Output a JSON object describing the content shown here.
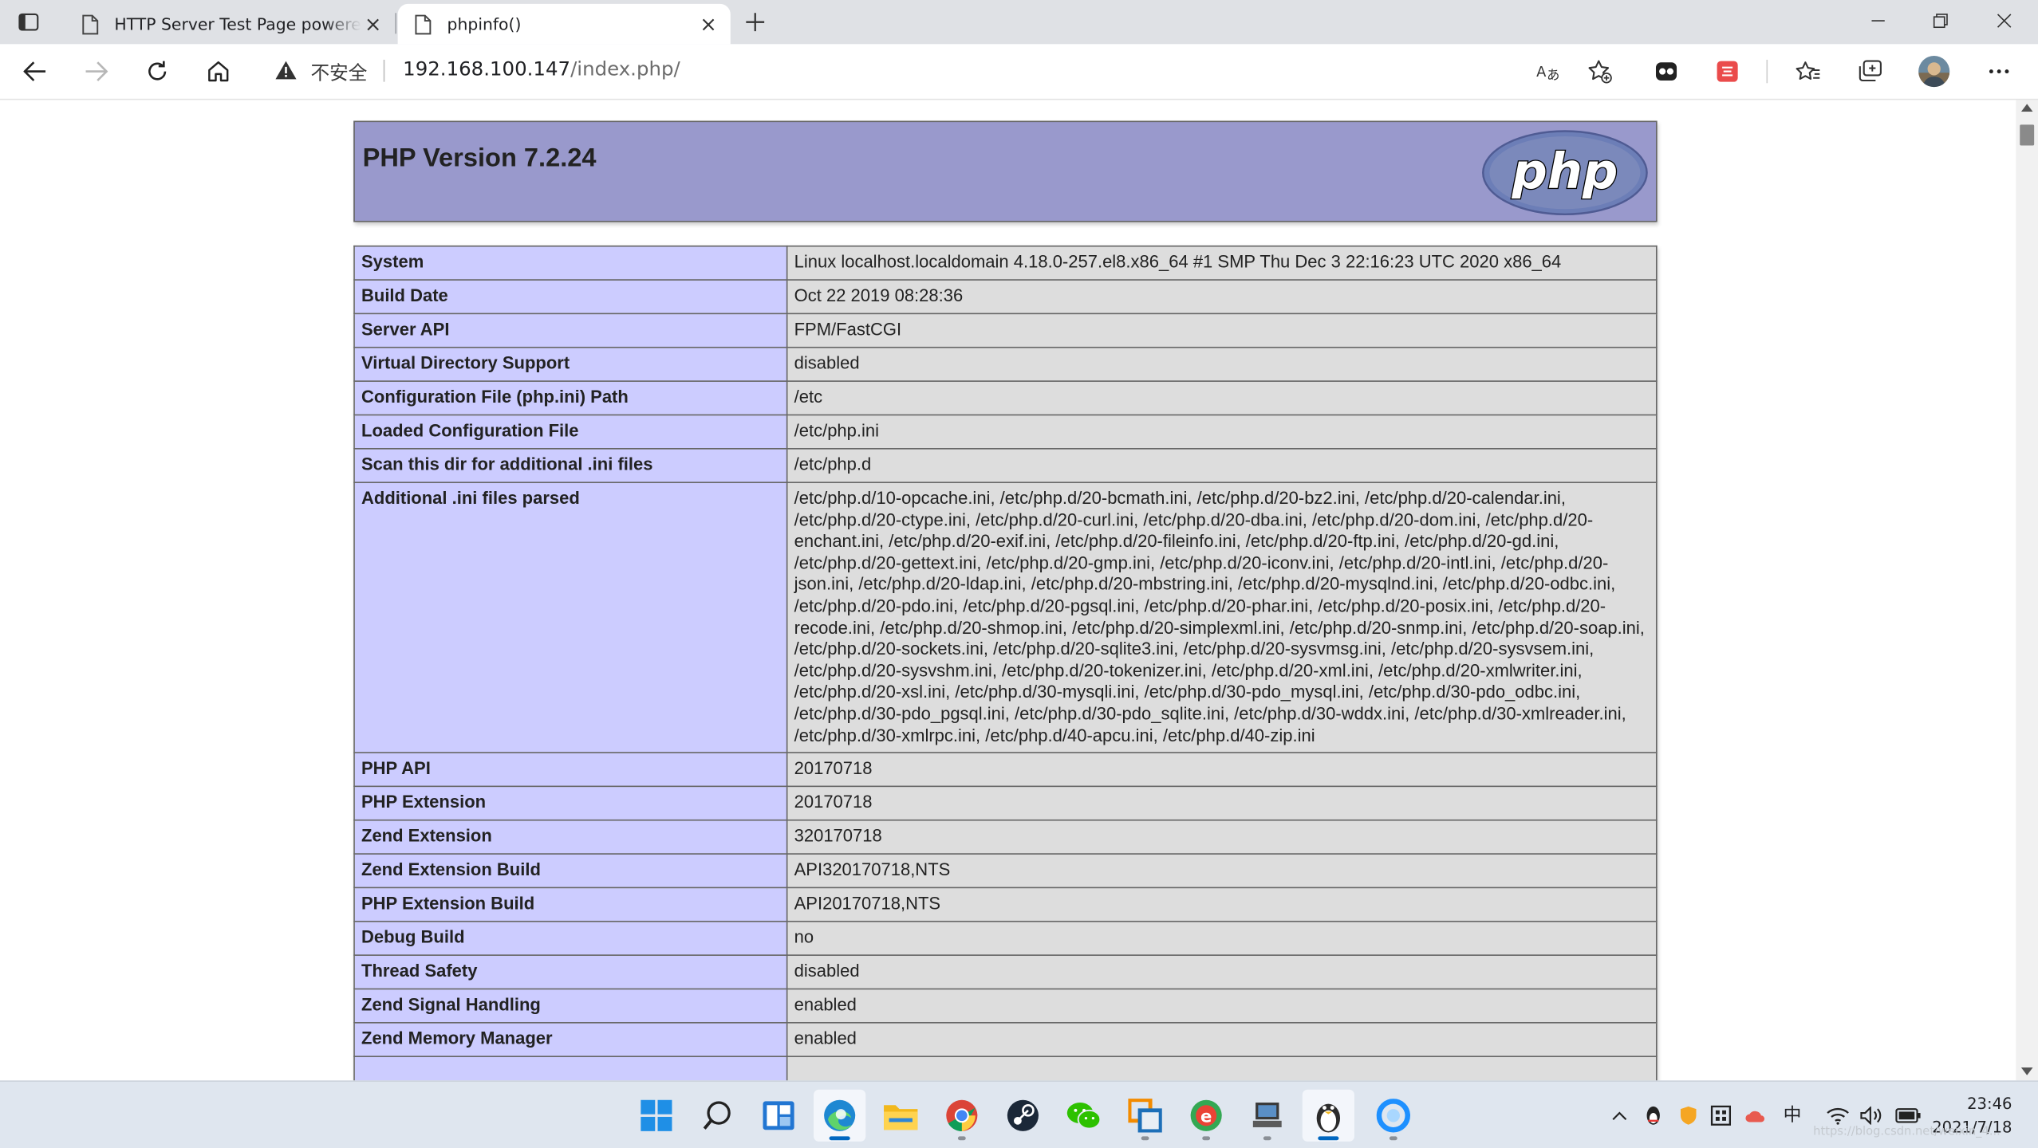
{
  "browser": {
    "tabs": [
      {
        "title": "HTTP Server Test Page powered by CentOS",
        "active": false
      },
      {
        "title": "phpinfo()",
        "active": true
      }
    ],
    "address": {
      "security_label": "不安全",
      "url_host": "192.168.100.147",
      "url_path": "/index.php/"
    },
    "icons": {
      "tab_actions": "tab-actions-icon",
      "back": "back-arrow-icon",
      "forward": "forward-arrow-icon",
      "refresh": "refresh-icon",
      "home": "home-icon",
      "read_aloud": "read-aloud-icon",
      "add_favorite": "add-favorite-icon",
      "favorites": "favorites-icon",
      "collections": "collections-icon",
      "more": "more-icon"
    }
  },
  "page": {
    "title": "PHP Version 7.2.24",
    "logo_text": "php",
    "rows": [
      {
        "key": "System",
        "value": "Linux localhost.localdomain 4.18.0-257.el8.x86_64 #1 SMP Thu Dec 3 22:16:23 UTC 2020 x86_64"
      },
      {
        "key": "Build Date",
        "value": "Oct 22 2019 08:28:36"
      },
      {
        "key": "Server API",
        "value": "FPM/FastCGI"
      },
      {
        "key": "Virtual Directory Support",
        "value": "disabled"
      },
      {
        "key": "Configuration File (php.ini) Path",
        "value": "/etc"
      },
      {
        "key": "Loaded Configuration File",
        "value": "/etc/php.ini"
      },
      {
        "key": "Scan this dir for additional .ini files",
        "value": "/etc/php.d"
      },
      {
        "key": "Additional .ini files parsed",
        "value": "/etc/php.d/10-opcache.ini, /etc/php.d/20-bcmath.ini, /etc/php.d/20-bz2.ini, /etc/php.d/20-calendar.ini, /etc/php.d/20-ctype.ini, /etc/php.d/20-curl.ini, /etc/php.d/20-dba.ini, /etc/php.d/20-dom.ini, /etc/php.d/20-enchant.ini, /etc/php.d/20-exif.ini, /etc/php.d/20-fileinfo.ini, /etc/php.d/20-ftp.ini, /etc/php.d/20-gd.ini, /etc/php.d/20-gettext.ini, /etc/php.d/20-gmp.ini, /etc/php.d/20-iconv.ini, /etc/php.d/20-intl.ini, /etc/php.d/20-json.ini, /etc/php.d/20-ldap.ini, /etc/php.d/20-mbstring.ini, /etc/php.d/20-mysqlnd.ini, /etc/php.d/20-odbc.ini, /etc/php.d/20-pdo.ini, /etc/php.d/20-pgsql.ini, /etc/php.d/20-phar.ini, /etc/php.d/20-posix.ini, /etc/php.d/20-recode.ini, /etc/php.d/20-shmop.ini, /etc/php.d/20-simplexml.ini, /etc/php.d/20-snmp.ini, /etc/php.d/20-soap.ini, /etc/php.d/20-sockets.ini, /etc/php.d/20-sqlite3.ini, /etc/php.d/20-sysvmsg.ini, /etc/php.d/20-sysvsem.ini, /etc/php.d/20-sysvshm.ini, /etc/php.d/20-tokenizer.ini, /etc/php.d/20-xml.ini, /etc/php.d/20-xmlwriter.ini, /etc/php.d/20-xsl.ini, /etc/php.d/30-mysqli.ini, /etc/php.d/30-pdo_mysql.ini, /etc/php.d/30-pdo_odbc.ini, /etc/php.d/30-pdo_pgsql.ini, /etc/php.d/30-pdo_sqlite.ini, /etc/php.d/30-wddx.ini, /etc/php.d/30-xmlreader.ini, /etc/php.d/30-xmlrpc.ini, /etc/php.d/40-apcu.ini, /etc/php.d/40-zip.ini"
      },
      {
        "key": "PHP API",
        "value": "20170718"
      },
      {
        "key": "PHP Extension",
        "value": "20170718"
      },
      {
        "key": "Zend Extension",
        "value": "320170718"
      },
      {
        "key": "Zend Extension Build",
        "value": "API320170718,NTS"
      },
      {
        "key": "PHP Extension Build",
        "value": "API20170718,NTS"
      },
      {
        "key": "Debug Build",
        "value": "no"
      },
      {
        "key": "Thread Safety",
        "value": "disabled"
      },
      {
        "key": "Zend Signal Handling",
        "value": "enabled"
      },
      {
        "key": "Zend Memory Manager",
        "value": "enabled"
      },
      {
        "key": "",
        "value": ""
      }
    ]
  },
  "taskbar": {
    "apps": [
      "start-icon",
      "search-icon",
      "widgets-icon",
      "edge-icon",
      "file-explorer-icon",
      "chrome-icon",
      "steam-icon",
      "wechat-icon",
      "vmware-icon",
      "browser-icon",
      "terminal-icon",
      "penguin-app-icon",
      "circle-app-icon"
    ],
    "ime": "中",
    "time": "23:46",
    "date": "2021/7/18",
    "watermark": "https://blog.csdn.net/weixin_4..."
  },
  "colors": {
    "header_bg": "#9999cc",
    "key_cell_bg": "#ccccff",
    "value_cell_bg": "#dddddd",
    "edge_accent": "#0067c0"
  }
}
